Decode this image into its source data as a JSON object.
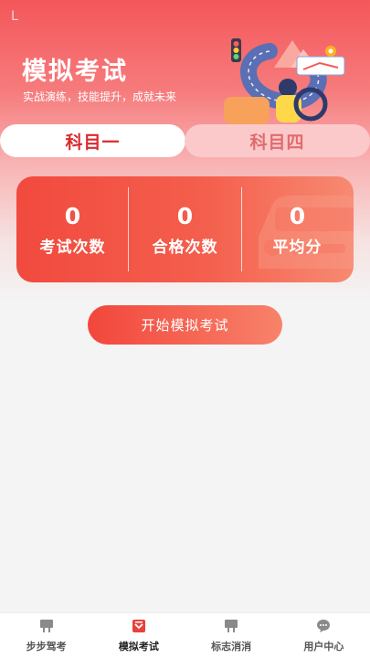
{
  "header": {
    "corner_mark": "L",
    "title": "模拟考试",
    "subtitle": "实战演练，技能提升，成就未来"
  },
  "subject_tabs": [
    {
      "label": "科目一",
      "active": true
    },
    {
      "label": "科目四",
      "active": false
    }
  ],
  "stats": [
    {
      "value": "0",
      "label": "考试次数"
    },
    {
      "value": "0",
      "label": "合格次数"
    },
    {
      "value": "0",
      "label": "平均分"
    }
  ],
  "start_button": {
    "label": "开始模拟考试"
  },
  "tabbar": [
    {
      "label": "步步驾考",
      "icon": "billboard-icon",
      "active": false
    },
    {
      "label": "模拟考试",
      "icon": "exam-icon",
      "active": true
    },
    {
      "label": "标志消消",
      "icon": "billboard-icon",
      "active": false
    },
    {
      "label": "用户中心",
      "icon": "chat-icon",
      "active": false
    }
  ],
  "colors": {
    "accent": "#f14a3e",
    "tab_active_text": "#d82a30",
    "tab_inactive_bg": "#fbc9c9"
  }
}
